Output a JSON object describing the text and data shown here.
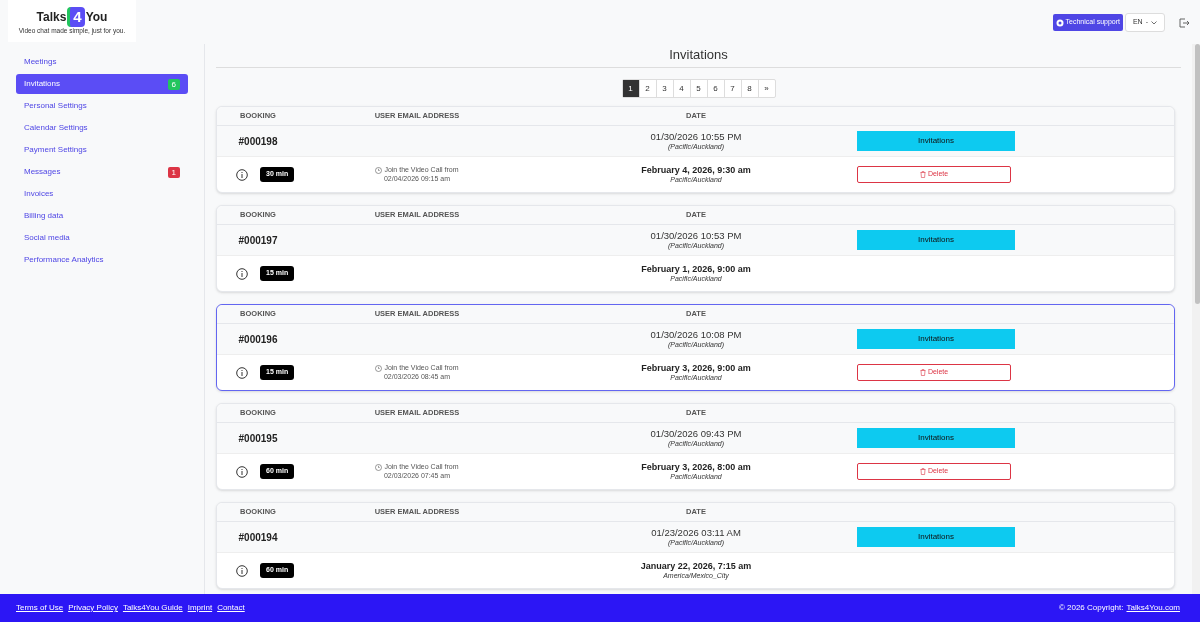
{
  "logo": {
    "word_start": "Talks",
    "digit": "4",
    "word_end": "You",
    "tagline": "Video chat made simple, just for you."
  },
  "header": {
    "support_button": "Technical support",
    "language": "EN",
    "language_suffix": "-"
  },
  "sidebar": {
    "items": [
      {
        "label": "Meetings",
        "selected": false
      },
      {
        "label": "Invitations",
        "selected": true,
        "badge": {
          "text": "6",
          "color": "#22c55e"
        }
      },
      {
        "label": "Personal Settings",
        "selected": false
      },
      {
        "label": "Calendar Settings",
        "selected": false
      },
      {
        "label": "Payment Settings",
        "selected": false
      },
      {
        "label": "Messages",
        "selected": false,
        "badge": {
          "text": "1",
          "color": "#dc3545"
        }
      },
      {
        "label": "Invoices",
        "selected": false
      },
      {
        "label": "Billing data",
        "selected": false
      },
      {
        "label": "Social media",
        "selected": false
      },
      {
        "label": "Performance Analytics",
        "selected": false
      }
    ]
  },
  "page_title": "Invitations",
  "pagination": {
    "pages": [
      {
        "label": "1",
        "selected": true
      },
      {
        "label": "2",
        "selected": false
      },
      {
        "label": "3",
        "selected": false
      },
      {
        "label": "4",
        "selected": false
      },
      {
        "label": "5",
        "selected": false
      },
      {
        "label": "6",
        "selected": false
      },
      {
        "label": "7",
        "selected": false
      },
      {
        "label": "8",
        "selected": false
      }
    ],
    "next": "»"
  },
  "bookings": [
    {
      "columns": [
        "BOOKING",
        "USER EMAIL ADDRESS",
        "DATE"
      ],
      "selected": false,
      "booking": "#000198",
      "created": "01/30/2026 10:55 PM",
      "created_zone": "(Pacific/Auckland)",
      "action": "Invitations",
      "duration": "30 min",
      "join_label": "Join the Video Call from",
      "join_time": "02/04/2026 09:15 am",
      "date": "February 4, 2026, 9:30 am",
      "zone": "Pacific/Auckland",
      "delete": "Delete"
    },
    {
      "columns": [
        "BOOKING",
        "USER EMAIL ADDRESS",
        "DATE"
      ],
      "selected": false,
      "booking": "#000197",
      "created": "01/30/2026 10:53 PM",
      "created_zone": "(Pacific/Auckland)",
      "action": "Invitations",
      "duration": "15 min",
      "date": "February 1, 2026, 9:00 am",
      "zone": "Pacific/Auckland"
    },
    {
      "columns": [
        "BOOKING",
        "USER EMAIL ADDRESS",
        "DATE"
      ],
      "selected": true,
      "booking": "#000196",
      "created": "01/30/2026 10:08 PM",
      "created_zone": "(Pacific/Auckland)",
      "action": "Invitations",
      "duration": "15 min",
      "join_label": "Join the Video Call from",
      "join_time": "02/03/2026 08:45 am",
      "date": "February 3, 2026, 9:00 am",
      "zone": "Pacific/Auckland",
      "delete": "Delete"
    },
    {
      "columns": [
        "BOOKING",
        "USER EMAIL ADDRESS",
        "DATE"
      ],
      "selected": false,
      "booking": "#000195",
      "created": "01/30/2026 09:43 PM",
      "created_zone": "(Pacific/Auckland)",
      "action": "Invitations",
      "duration": "60 min",
      "join_label": "Join the Video Call from",
      "join_time": "02/03/2026 07:45 am",
      "date": "February 3, 2026, 8:00 am",
      "zone": "Pacific/Auckland",
      "delete": "Delete"
    },
    {
      "columns": [
        "BOOKING",
        "USER EMAIL ADDRESS",
        "DATE"
      ],
      "selected": false,
      "booking": "#000194",
      "created": "01/23/2026 03:11 AM",
      "created_zone": "(Pacific/Auckland)",
      "action": "Invitations",
      "duration": "60 min",
      "date": "January 22, 2026, 7:15 am",
      "zone": "America/Mexico_City"
    }
  ],
  "footer": {
    "links": [
      "Terms of Use",
      "Privacy Policy",
      "Talks4You Guide",
      "Imprint",
      "Contact"
    ],
    "copyright": "© 2026 Copyright:",
    "copyright_link": "Talks4You.com"
  }
}
